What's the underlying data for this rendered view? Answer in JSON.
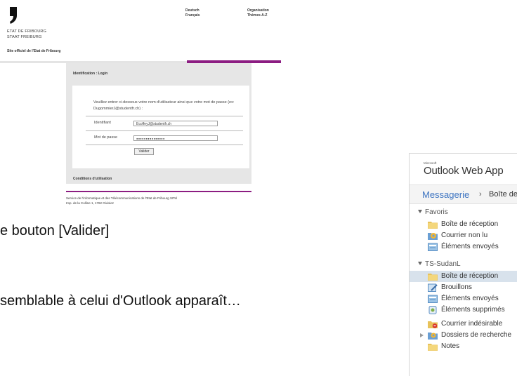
{
  "fribourg": {
    "org_line1": "ETAT DE FRIBOURG",
    "org_line2": "STAAT FREIBURG",
    "site_label": "Site officiel de l'Etat de Fribourg",
    "lang_de": "Deutsch",
    "lang_fr": "Français",
    "nav_org": "Organisation",
    "nav_themes": "Thèmes A-Z",
    "id_heading": "Identification : Login",
    "instructions": "Veuillez entrer ci-dessous votre nom d'utilisateur ainsi que votre mot de passe (ex: DugommierJ@studentfr.ch) :",
    "identifiant_label": "Identifiant",
    "identifiant_value": "EcoffeyJ@studentfr.ch",
    "password_label": "Mot de passe",
    "password_value": "●●●●●●●●●●●●●●●",
    "submit_label": "Valider",
    "conditions": "Conditions d'utilisation",
    "footer_line1": "Service de l'informatique et des Télécommunications de l'Etat de Fribourg SITel",
    "footer_line2": "Imp. de la Colline 1, 1762 Givisiez",
    "accent_color": "#8c1d82"
  },
  "captions": {
    "line1": "e bouton [Valider]",
    "line2": "semblable à celui d'Outlook apparaît…"
  },
  "owa": {
    "brand_small": "Microsoft",
    "title": "Outlook Web App",
    "crumb_root": "Messagerie",
    "crumb_sep": "›",
    "crumb_current": "Boîte de ré",
    "favorites_heading": "Favoris",
    "favorites": [
      {
        "label": "Boîte de réception",
        "icon": "inbox-folder-icon"
      },
      {
        "label": "Courrier non lu",
        "icon": "unread-mail-icon"
      },
      {
        "label": "Éléments envoyés",
        "icon": "sent-items-icon"
      }
    ],
    "mailbox_heading": "TS-SudanL",
    "mailbox": [
      {
        "label": "Boîte de réception",
        "icon": "inbox-folder-icon",
        "selected": true
      },
      {
        "label": "Brouillons",
        "icon": "drafts-icon"
      },
      {
        "label": "Éléments envoyés",
        "icon": "sent-items-icon"
      },
      {
        "label": "Éléments supprimés",
        "icon": "deleted-items-icon"
      },
      {
        "label": "Courrier indésirable",
        "icon": "junk-mail-icon"
      },
      {
        "label": "Dossiers de recherche",
        "icon": "search-folders-icon"
      },
      {
        "label": "Notes",
        "icon": "notes-icon"
      }
    ],
    "link_color": "#3d74c1",
    "selected_color": "#d8e2ec"
  }
}
